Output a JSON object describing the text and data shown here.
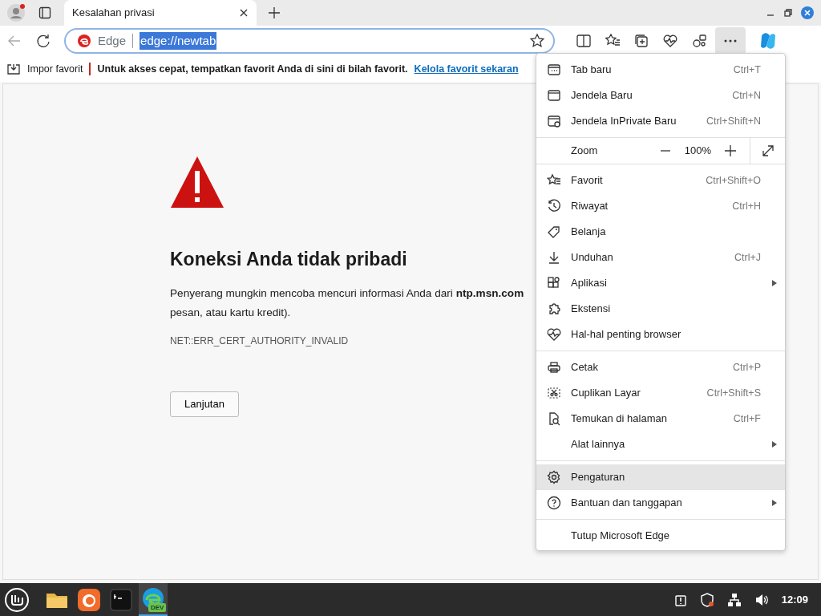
{
  "tab": {
    "title": "Kesalahan privasi",
    "selected": true
  },
  "address_bar": {
    "site_label": "Edge",
    "url": "edge://newtab",
    "url_selected": true
  },
  "favorites_bar": {
    "import_label": "Impor favorit",
    "hint": "Untuk akses cepat, tempatkan favorit Anda di sini di bilah favorit.",
    "link": "Kelola favorit sekaran"
  },
  "error_page": {
    "heading": "Koneksi Anda tidak pribadi",
    "paragraph_lines": [
      "Penyerang mungkin mencoba mencuri informasi Anda dari **ntp.msn.com**",
      "pesan, atau kartu kredit)."
    ],
    "error_code": "NET::ERR_CERT_AUTHORITY_INVALID",
    "button": "Lanjutan"
  },
  "menu": {
    "items": [
      {
        "kind": "item",
        "label": "Tab baru",
        "shortcut": "Ctrl+T",
        "submenu": false,
        "hovered": false
      },
      {
        "kind": "item",
        "label": "Jendela Baru",
        "shortcut": "Ctrl+N",
        "submenu": false,
        "hovered": false
      },
      {
        "kind": "item",
        "label": "Jendela InPrivate Baru",
        "shortcut": "Ctrl+Shift+N",
        "submenu": false,
        "hovered": false
      },
      {
        "kind": "zoom",
        "label": "Zoom",
        "value": "100%"
      },
      {
        "kind": "item",
        "label": "Favorit",
        "shortcut": "Ctrl+Shift+O",
        "submenu": false,
        "hovered": false
      },
      {
        "kind": "item",
        "label": "Riwayat",
        "shortcut": "Ctrl+H",
        "submenu": false,
        "hovered": false
      },
      {
        "kind": "item",
        "label": "Belanja",
        "submenu": false,
        "hovered": false
      },
      {
        "kind": "item",
        "label": "Unduhan",
        "shortcut": "Ctrl+J",
        "submenu": false,
        "hovered": false
      },
      {
        "kind": "item",
        "label": "Aplikasi",
        "submenu": true,
        "hovered": false
      },
      {
        "kind": "item",
        "label": "Ekstensi",
        "submenu": false,
        "hovered": false
      },
      {
        "kind": "item",
        "label": "Hal-hal penting browser",
        "submenu": false,
        "hovered": false
      },
      {
        "kind": "separator"
      },
      {
        "kind": "item",
        "label": "Cetak",
        "shortcut": "Ctrl+P",
        "submenu": false,
        "hovered": false
      },
      {
        "kind": "item",
        "label": "Cuplikan Layar",
        "shortcut": "Ctrl+Shift+S",
        "submenu": false,
        "hovered": false
      },
      {
        "kind": "item",
        "label": "Temukan di halaman",
        "shortcut": "Ctrl+F",
        "submenu": false,
        "hovered": false
      },
      {
        "kind": "item",
        "label": "Alat lainnya",
        "submenu": true,
        "hovered": false
      },
      {
        "kind": "separator"
      },
      {
        "kind": "item",
        "label": "Pengaturan",
        "submenu": false,
        "hovered": true
      },
      {
        "kind": "item",
        "label": "Bantuan dan tanggapan",
        "submenu": true,
        "hovered": false
      },
      {
        "kind": "separator"
      },
      {
        "kind": "item",
        "label": "Tutup Microsoft Edge",
        "submenu": false,
        "hovered": false
      }
    ]
  },
  "taskbar": {
    "apps": [
      {
        "kind": "files",
        "active": false
      },
      {
        "kind": "firefox",
        "active": false
      },
      {
        "kind": "terminal",
        "active": false
      },
      {
        "kind": "edge",
        "active": true,
        "badge": "DEV"
      }
    ],
    "clock": "12:09"
  }
}
